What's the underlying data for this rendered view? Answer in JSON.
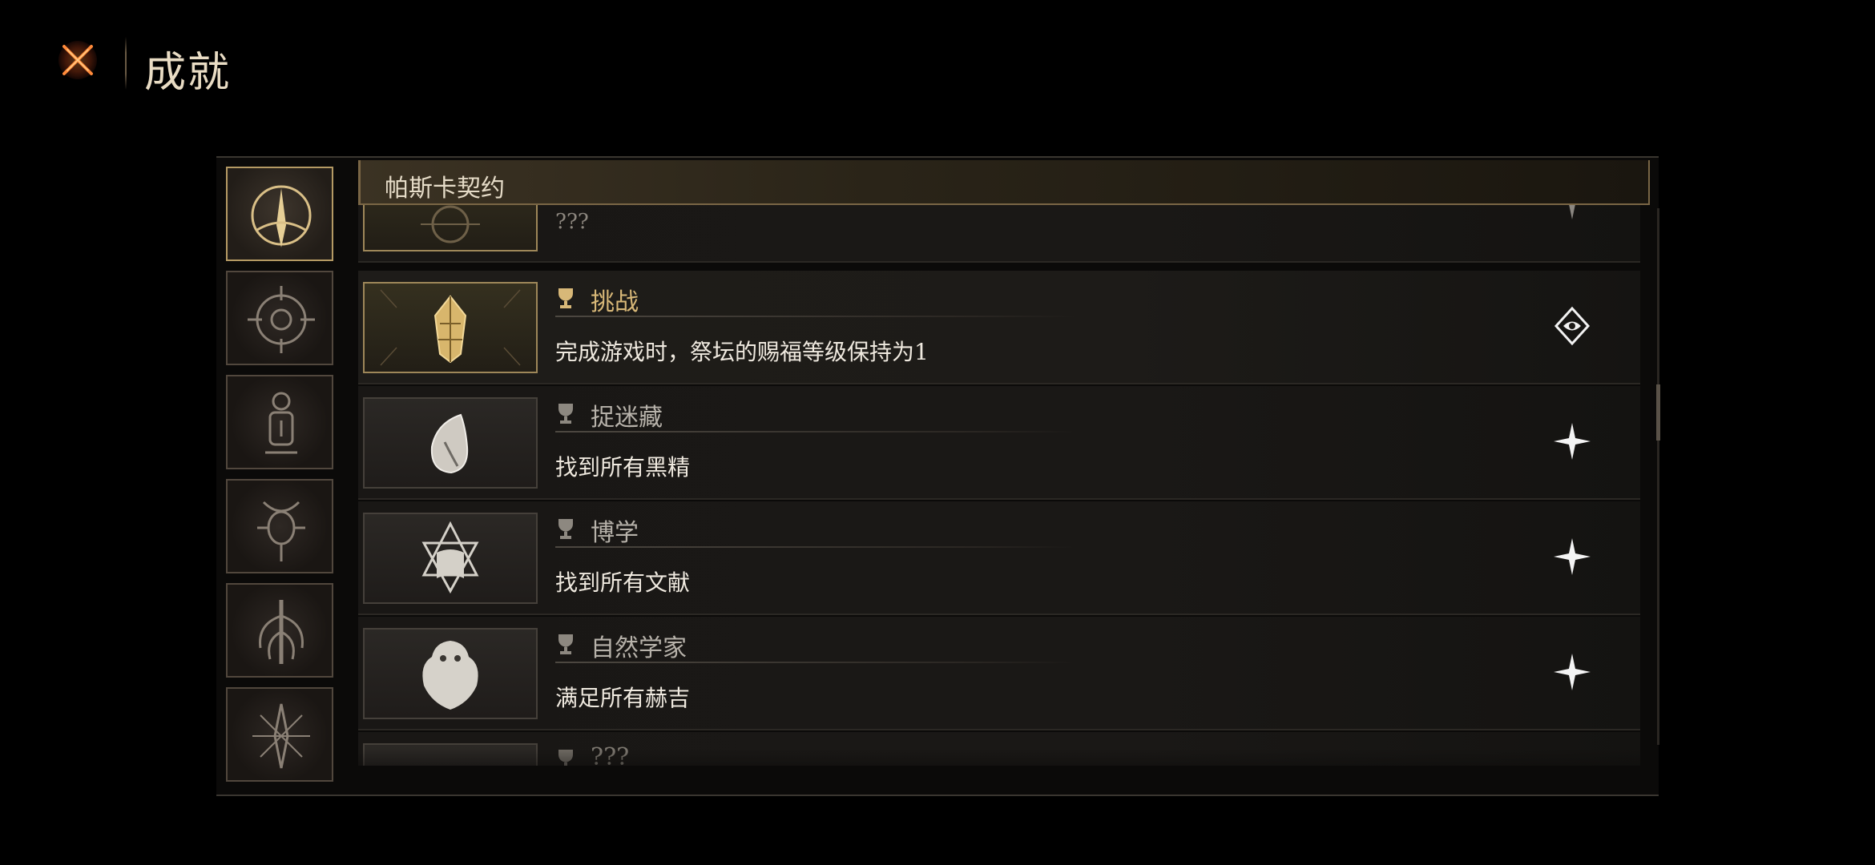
{
  "header": {
    "title": "成就",
    "close_icon": "close-x-icon"
  },
  "section": {
    "title": "帕斯卡契约"
  },
  "sidebar": {
    "categories": [
      {
        "icon": "sun-blade-emblem-icon",
        "active": true
      },
      {
        "icon": "eye-sigil-emblem-icon",
        "active": false
      },
      {
        "icon": "lantern-emblem-icon",
        "active": false
      },
      {
        "icon": "horned-eye-emblem-icon",
        "active": false
      },
      {
        "icon": "tentacle-emblem-icon",
        "active": false
      },
      {
        "icon": "thorn-crest-emblem-icon",
        "active": false
      }
    ]
  },
  "achievements": [
    {
      "title": "",
      "desc": "???",
      "icon": "partial-emblem-icon",
      "status": "partial"
    },
    {
      "title": "挑战",
      "desc": "完成游戏时，祭坛的赐福等级保持为1",
      "icon": "crystal-crest-icon",
      "status": "achieved",
      "active": true
    },
    {
      "title": "捉迷藏",
      "desc": "找到所有黑精",
      "icon": "shell-icon",
      "status": "locked"
    },
    {
      "title": "博学",
      "desc": "找到所有文献",
      "icon": "star-book-icon",
      "status": "locked"
    },
    {
      "title": "自然学家",
      "desc": "满足所有赫吉",
      "icon": "creature-icon",
      "status": "locked"
    },
    {
      "title": "???",
      "desc": "",
      "icon": "unknown-icon",
      "status": "locked"
    }
  ],
  "colors": {
    "accent_gold": "#d8b878",
    "background": "#000000",
    "panel": "#0b0a09"
  }
}
